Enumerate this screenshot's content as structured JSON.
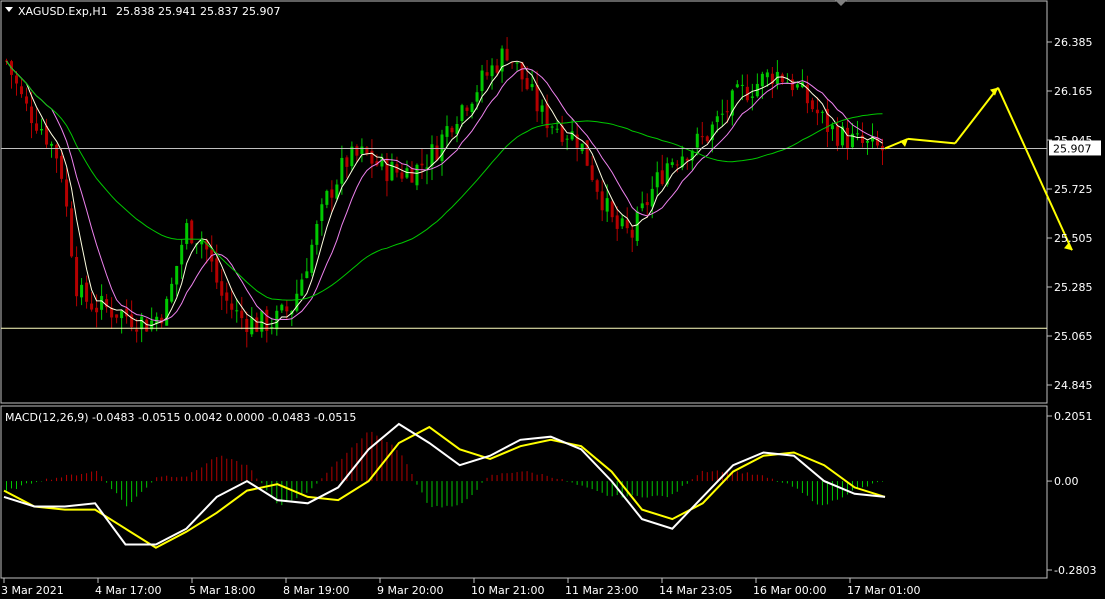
{
  "header": {
    "symbol": "XAGUSD.Exp,H1",
    "ohlc": "25.838 25.941 25.837 25.907"
  },
  "price_axis": {
    "labels": [
      "26.385",
      "26.165",
      "25.945",
      "25.725",
      "25.505",
      "25.285",
      "25.065",
      "24.845"
    ],
    "current_price": "25.907"
  },
  "macd_panel": {
    "title": "MACD(12,26,9) -0.0483 -0.0515 0.0042 0.0000 -0.0483 -0.0515",
    "axis_labels": [
      "0.2051",
      "0.00",
      "-0.2803"
    ]
  },
  "time_axis": {
    "labels": [
      "3 Mar 2021",
      "4 Mar 17:00",
      "5 Mar 18:00",
      "8 Mar 19:00",
      "9 Mar 20:00",
      "10 Mar 21:00",
      "11 Mar 23:00",
      "14 Mar 23:05",
      "16 Mar 00:00",
      "17 Mar 01:00"
    ]
  },
  "colors": {
    "background": "#000000",
    "bull": "#00c800",
    "bear": "#b40000",
    "ma_fast": "#ffffe0",
    "ma_mid": "#ee82ee",
    "ma_slow": "#00c800",
    "macd_line": "#ffffff",
    "signal_line": "#ffff00",
    "forecast": "#ffff00",
    "grid_border": "#c0c0c0"
  },
  "chart_data": [
    {
      "type": "candlestick",
      "title": "XAGUSD.Exp,H1",
      "ylim": [
        24.8,
        26.5
      ],
      "horizontal_levels": [
        25.907,
        25.1
      ],
      "close_path": [
        26.3,
        26.1,
        26.0,
        25.85,
        25.25,
        25.2,
        25.18,
        25.15,
        25.12,
        25.2,
        25.55,
        25.5,
        25.25,
        25.15,
        25.12,
        25.13,
        25.2,
        25.45,
        25.7,
        25.85,
        25.88,
        25.82,
        25.8,
        25.82,
        25.9,
        26.05,
        26.15,
        26.25,
        26.35,
        26.2,
        26.05,
        26.0,
        25.95,
        25.75,
        25.55,
        25.52,
        25.7,
        25.85,
        25.9,
        25.95,
        26.05,
        26.15,
        26.2,
        26.25,
        26.2,
        26.1,
        26.0,
        25.95,
        25.92,
        25.9
      ],
      "forecast_path": [
        25.907,
        25.95,
        25.93,
        26.18,
        25.45
      ]
    },
    {
      "type": "macd",
      "title": "MACD(12,26,9)",
      "ylim": [
        -0.2803,
        0.2051
      ],
      "macd": [
        -0.05,
        -0.08,
        -0.08,
        -0.07,
        -0.2,
        -0.2,
        -0.15,
        -0.05,
        0.0,
        -0.06,
        -0.07,
        -0.02,
        0.1,
        0.18,
        0.12,
        0.05,
        0.08,
        0.13,
        0.14,
        0.1,
        0.0,
        -0.12,
        -0.15,
        -0.05,
        0.05,
        0.09,
        0.08,
        0.0,
        -0.04,
        -0.05
      ],
      "signal": [
        -0.03,
        -0.08,
        -0.09,
        -0.09,
        -0.15,
        -0.21,
        -0.16,
        -0.1,
        -0.03,
        -0.01,
        -0.05,
        -0.06,
        0.0,
        0.12,
        0.17,
        0.1,
        0.07,
        0.11,
        0.13,
        0.11,
        0.03,
        -0.09,
        -0.12,
        -0.07,
        0.03,
        0.08,
        0.09,
        0.05,
        -0.02,
        -0.05
      ],
      "histogram": [
        -0.02,
        0.0,
        0.01,
        0.02,
        -0.05,
        0.01,
        0.01,
        0.05,
        0.03,
        -0.05,
        -0.02,
        0.04,
        0.1,
        0.06,
        -0.05,
        -0.05,
        0.01,
        0.02,
        0.01,
        -0.01,
        -0.03,
        -0.03,
        -0.03,
        0.02,
        0.02,
        0.01,
        -0.01,
        -0.05,
        -0.02,
        0.0
      ]
    }
  ]
}
